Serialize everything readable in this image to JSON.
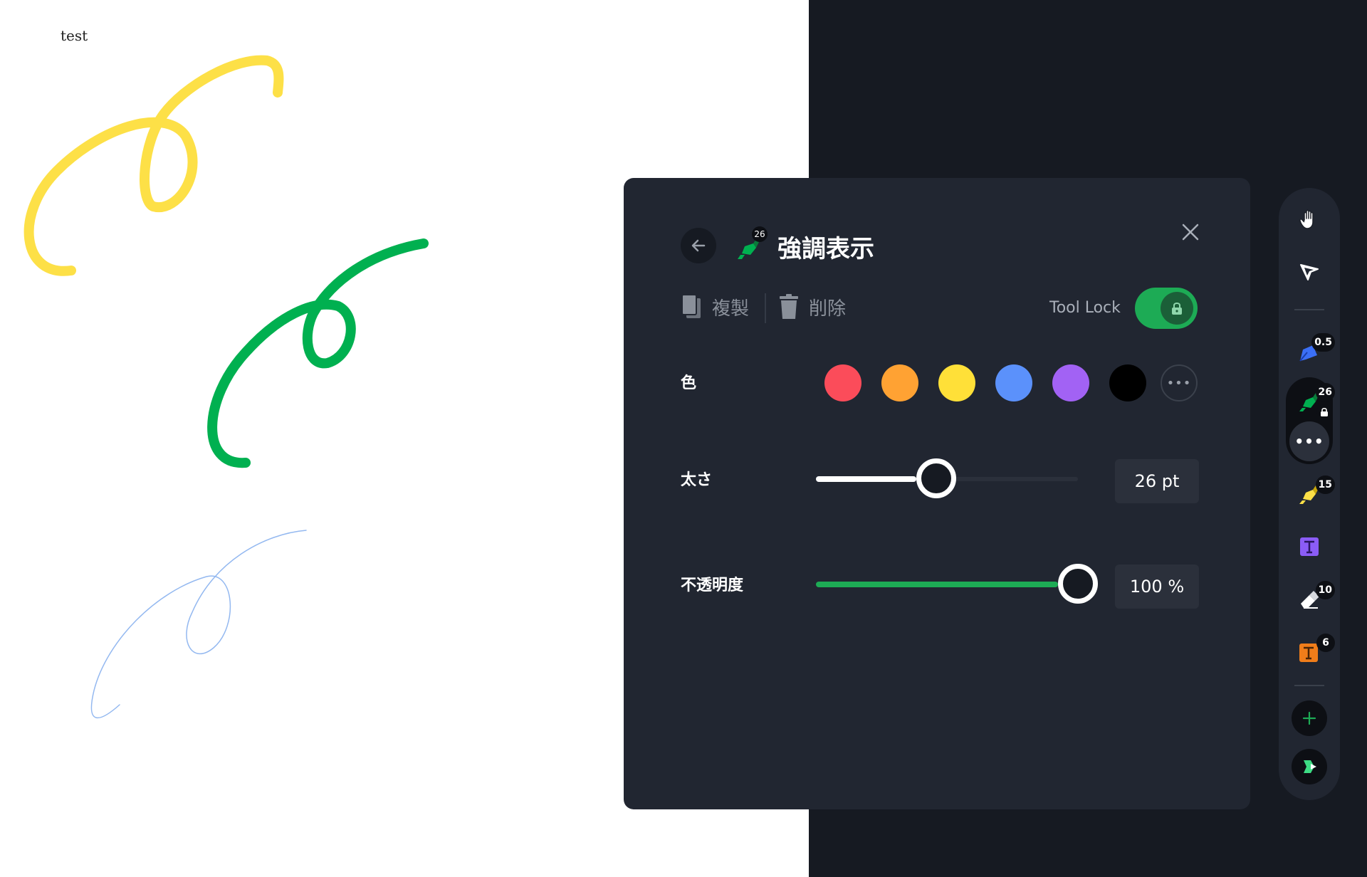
{
  "canvas": {
    "label": "test",
    "strokes": [
      {
        "color": "#fde047",
        "name": "yellow"
      },
      {
        "color": "#00b050",
        "name": "green"
      },
      {
        "color": "#93b8f0",
        "name": "blue"
      }
    ]
  },
  "panel": {
    "title": "強調表示",
    "tool_size_badge": "26",
    "actions": {
      "duplicate": "複製",
      "delete": "削除"
    },
    "tool_lock": {
      "label": "Tool Lock",
      "on": true
    },
    "color": {
      "label": "色",
      "swatches": [
        "#fb4c5a",
        "#ffa233",
        "#ffe038",
        "#5b91fb",
        "#a262f4",
        "#000000"
      ],
      "more_label": "•••"
    },
    "thickness": {
      "label": "太さ",
      "value": "26 pt",
      "fraction": 0.46
    },
    "opacity": {
      "label": "不透明度",
      "value": "100 %",
      "fraction": 1.0,
      "fill_color": "#1dab55"
    }
  },
  "toolbar": {
    "items": [
      {
        "name": "hand-tool",
        "icon": "hand-icon"
      },
      {
        "name": "select-tool",
        "icon": "pointer-icon"
      },
      {
        "name": "pen-tool",
        "icon": "pen-icon",
        "badge": "0.5",
        "color": "#3b6ff5"
      },
      {
        "name": "highlighter-tool",
        "icon": "highlighter-icon",
        "badge": "26",
        "color": "#00b050",
        "active": true
      },
      {
        "name": "marker-tool",
        "icon": "marker-icon",
        "badge": "15",
        "color": "#fde047"
      },
      {
        "name": "text-tool",
        "icon": "text-box-icon",
        "color": "#8b5cf6"
      },
      {
        "name": "eraser-tool",
        "icon": "eraser-icon",
        "badge": "10"
      },
      {
        "name": "stamp-text-tool",
        "icon": "text-stamp-icon",
        "badge": "6",
        "color": "#f07d1a"
      }
    ],
    "more_label": "•••"
  }
}
